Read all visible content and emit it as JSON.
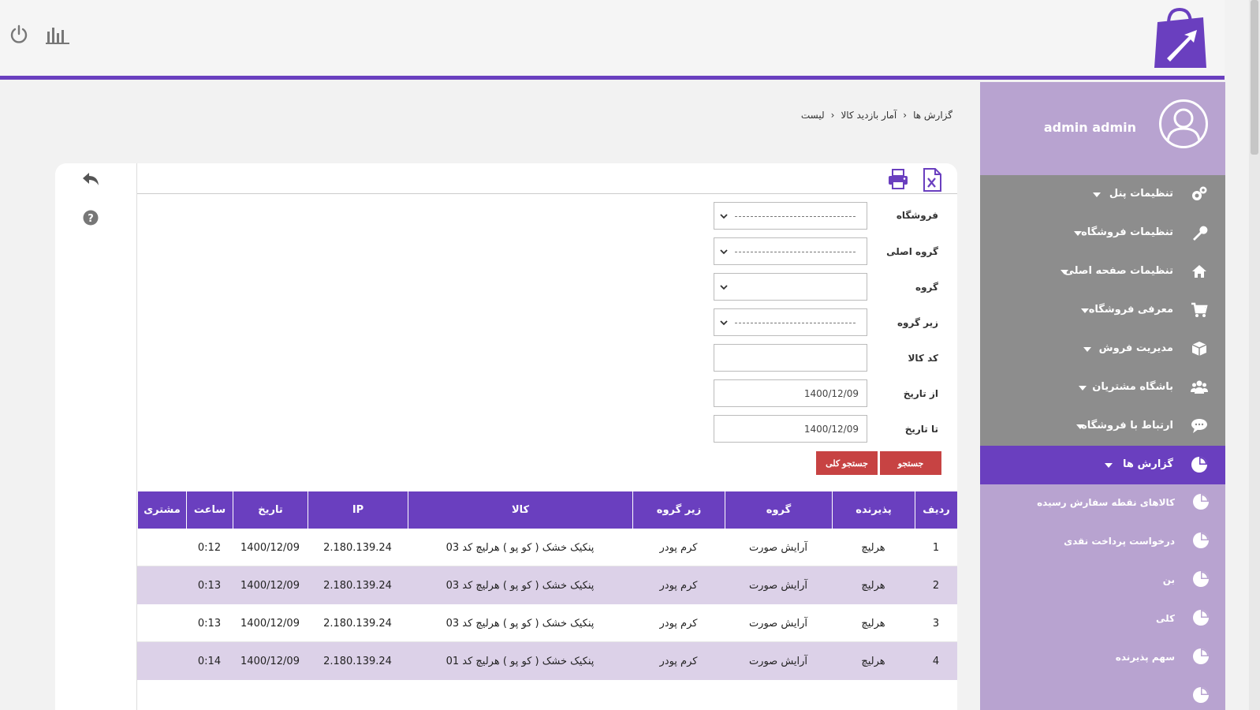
{
  "header": {
    "logo_icon": "shopping-bag-logo-icon",
    "power_icon": "power-icon",
    "stats_icon": "bar-chart-icon"
  },
  "colors": {
    "primary": "#6a3fbf",
    "sidebar_gray": "#8d8d8d",
    "sidebar_light": "#b8a3d0",
    "button_red": "#c74343",
    "row_alt": "#dcd1e8"
  },
  "profile": {
    "username": "admin admin"
  },
  "sidebar": {
    "items": [
      {
        "label": "تنظیمات پنل",
        "icon": "gears-icon"
      },
      {
        "label": "تنظیمات فروشگاه",
        "icon": "wrench-icon"
      },
      {
        "label": "تنظیمات صفحه اصلی",
        "icon": "home-icon"
      },
      {
        "label": "معرفی فروشگاه",
        "icon": "cart-icon"
      },
      {
        "label": "مدیریت فروش",
        "icon": "box-icon"
      },
      {
        "label": "باشگاه مشتریان",
        "icon": "users-icon"
      },
      {
        "label": "ارتباط با فروشگاه",
        "icon": "chat-icon"
      },
      {
        "label": "گزارش ها",
        "icon": "pie-chart-icon"
      }
    ],
    "subitems": [
      {
        "label": "کالاهای نقطه سفارش رسیده"
      },
      {
        "label": "درخواست پرداخت نقدی"
      },
      {
        "label": "بن"
      },
      {
        "label": "کلی"
      },
      {
        "label": "سهم پذیرنده"
      },
      {
        "label": ""
      }
    ]
  },
  "breadcrumb": {
    "level1": "گزارش ها",
    "level2": "آمار بازدید کالا",
    "level3": "لیست",
    "separator": "‹"
  },
  "toolbar": {
    "excel_icon": "excel-icon",
    "print_icon": "print-icon",
    "back_icon": "reply-icon",
    "help_icon": "help-icon"
  },
  "form": {
    "store_label": "فروشگاه",
    "main_group_label": "گروه اصلی",
    "group_label": "گروه",
    "subgroup_label": "زیر گروه",
    "code_label": "کد کالا",
    "from_date_label": "از تاریخ",
    "to_date_label": "تا تاریخ",
    "from_date_value": "1400/12/09",
    "to_date_value": "1400/12/09",
    "search_button": "جستجو",
    "search_all_button": "جستجو کلی"
  },
  "table": {
    "headers": [
      "ردیف",
      "پذیرنده",
      "گروه",
      "زیر گروه",
      "کالا",
      "IP",
      "تاریخ",
      "ساعت",
      "مشتری"
    ],
    "rows": [
      [
        "1",
        "هرلیچ",
        "آرایش صورت",
        "کرم پودر",
        "پنکیک خشک ( کو پو ) هرلیچ کد 03",
        "2.180.139.24",
        "1400/12/09",
        "0:12",
        ""
      ],
      [
        "2",
        "هرلیچ",
        "آرایش صورت",
        "کرم پودر",
        "پنکیک خشک ( کو پو ) هرلیچ کد 03",
        "2.180.139.24",
        "1400/12/09",
        "0:13",
        ""
      ],
      [
        "3",
        "هرلیچ",
        "آرایش صورت",
        "کرم پودر",
        "پنکیک خشک ( کو پو ) هرلیچ کد 03",
        "2.180.139.24",
        "1400/12/09",
        "0:13",
        ""
      ],
      [
        "4",
        "هرلیچ",
        "آرایش صورت",
        "کرم پودر",
        "پنکیک خشک ( کو پو ) هرلیچ کد 01",
        "2.180.139.24",
        "1400/12/09",
        "0:14",
        ""
      ]
    ]
  }
}
